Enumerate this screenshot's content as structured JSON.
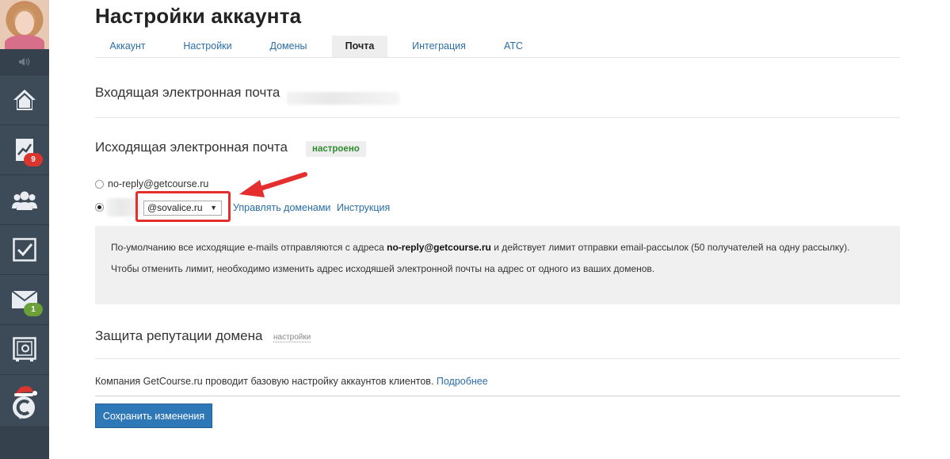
{
  "sidebar": {
    "items": [
      {
        "icon": "home-icon",
        "badge": ""
      },
      {
        "icon": "chart-icon",
        "badge": "9",
        "badge_color": "#d9362f"
      },
      {
        "icon": "users-icon",
        "badge": ""
      },
      {
        "icon": "tasks-icon",
        "badge": ""
      },
      {
        "icon": "mail-icon",
        "badge": "1",
        "badge_color": "#6a9f3a"
      },
      {
        "icon": "safe-icon",
        "badge": ""
      },
      {
        "icon": "getcourse-logo-icon",
        "badge": ""
      }
    ]
  },
  "page": {
    "title": "Настройки аккаунта"
  },
  "tabs": [
    {
      "label": "Аккаунт",
      "active": false
    },
    {
      "label": "Настройки",
      "active": false
    },
    {
      "label": "Домены",
      "active": false
    },
    {
      "label": "Почта",
      "active": true
    },
    {
      "label": "Интеграция",
      "active": false
    },
    {
      "label": "АТС",
      "active": false
    }
  ],
  "incoming": {
    "title": "Входящая электронная почта"
  },
  "outgoing": {
    "title": "Исходящая электронная почта",
    "status": "настроено",
    "status_color": "#2e8b2e",
    "option_default": "no-reply@getcourse.ru",
    "domain_value": "@sovalice.ru",
    "manage_domains": "Управлять доменами",
    "instruction": "Инструкция"
  },
  "info": {
    "line1_prefix": "По-умолчанию все исходящие e-mails отправляются с адреса ",
    "line1_email": "no-reply@getcourse.ru",
    "line1_suffix": " и действует лимит отправки email-рассылок (50 получателей на одну рассылку).",
    "line2": "Чтобы отменить лимит, необходимо изменить адрес исходяшей электронной почты на адрес от одного из ваших доменов."
  },
  "reputation": {
    "title": "Защита репутации домена",
    "settings_link": "настройки"
  },
  "footer": {
    "text": "Компания GetCourse.ru проводит базовую настройку аккаунтов клиентов. ",
    "more_link": "Подробнее",
    "save_button": "Сохранить изменения"
  },
  "colors": {
    "accent": "#2f78b7",
    "link": "#2a6da8",
    "sidebar": "#3d4a57",
    "highlight": "#e52e2e"
  }
}
